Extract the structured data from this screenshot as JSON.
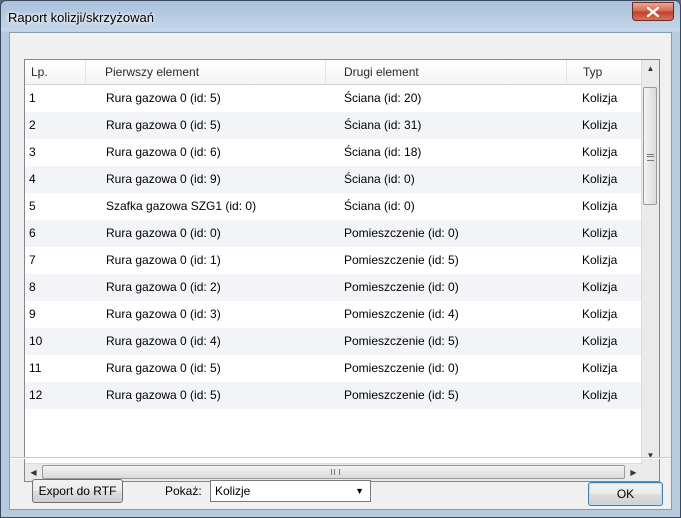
{
  "window": {
    "title": "Raport kolizji/skrzyżowań"
  },
  "table": {
    "columns": [
      "Lp.",
      "Pierwszy element",
      "Drugi element",
      "Typ"
    ],
    "rows": [
      [
        "1",
        "Rura gazowa 0 (id: 5)",
        "Ściana (id: 20)",
        "Kolizja"
      ],
      [
        "2",
        "Rura gazowa 0 (id: 5)",
        "Ściana (id: 31)",
        "Kolizja"
      ],
      [
        "3",
        "Rura gazowa 0 (id: 6)",
        "Ściana (id: 18)",
        "Kolizja"
      ],
      [
        "4",
        "Rura gazowa 0 (id: 9)",
        "Ściana (id: 0)",
        "Kolizja"
      ],
      [
        "5",
        "Szafka gazowa SZG1 (id: 0)",
        "Ściana (id: 0)",
        "Kolizja"
      ],
      [
        "6",
        "Rura gazowa 0 (id: 0)",
        "Pomieszczenie (id: 0)",
        "Kolizja"
      ],
      [
        "7",
        "Rura gazowa 0 (id: 1)",
        "Pomieszczenie (id: 5)",
        "Kolizja"
      ],
      [
        "8",
        "Rura gazowa 0 (id: 2)",
        "Pomieszczenie (id: 0)",
        "Kolizja"
      ],
      [
        "9",
        "Rura gazowa 0 (id: 3)",
        "Pomieszczenie (id: 4)",
        "Kolizja"
      ],
      [
        "10",
        "Rura gazowa 0 (id: 4)",
        "Pomieszczenie (id: 5)",
        "Kolizja"
      ],
      [
        "11",
        "Rura gazowa 0 (id: 5)",
        "Pomieszczenie (id: 0)",
        "Kolizja"
      ],
      [
        "12",
        "Rura gazowa 0 (id: 5)",
        "Pomieszczenie (id: 5)",
        "Kolizja"
      ]
    ]
  },
  "footer": {
    "export_label": "Export do RTF",
    "show_label": "Pokaż:",
    "show_value": "Kolizje",
    "ok_label": "OK"
  },
  "icons": {
    "close": "close-icon",
    "scroll_up": "arrow-up-icon",
    "scroll_down": "arrow-down-icon",
    "scroll_left": "arrow-left-icon",
    "scroll_right": "arrow-right-icon",
    "dropdown": "chevron-down-icon"
  }
}
